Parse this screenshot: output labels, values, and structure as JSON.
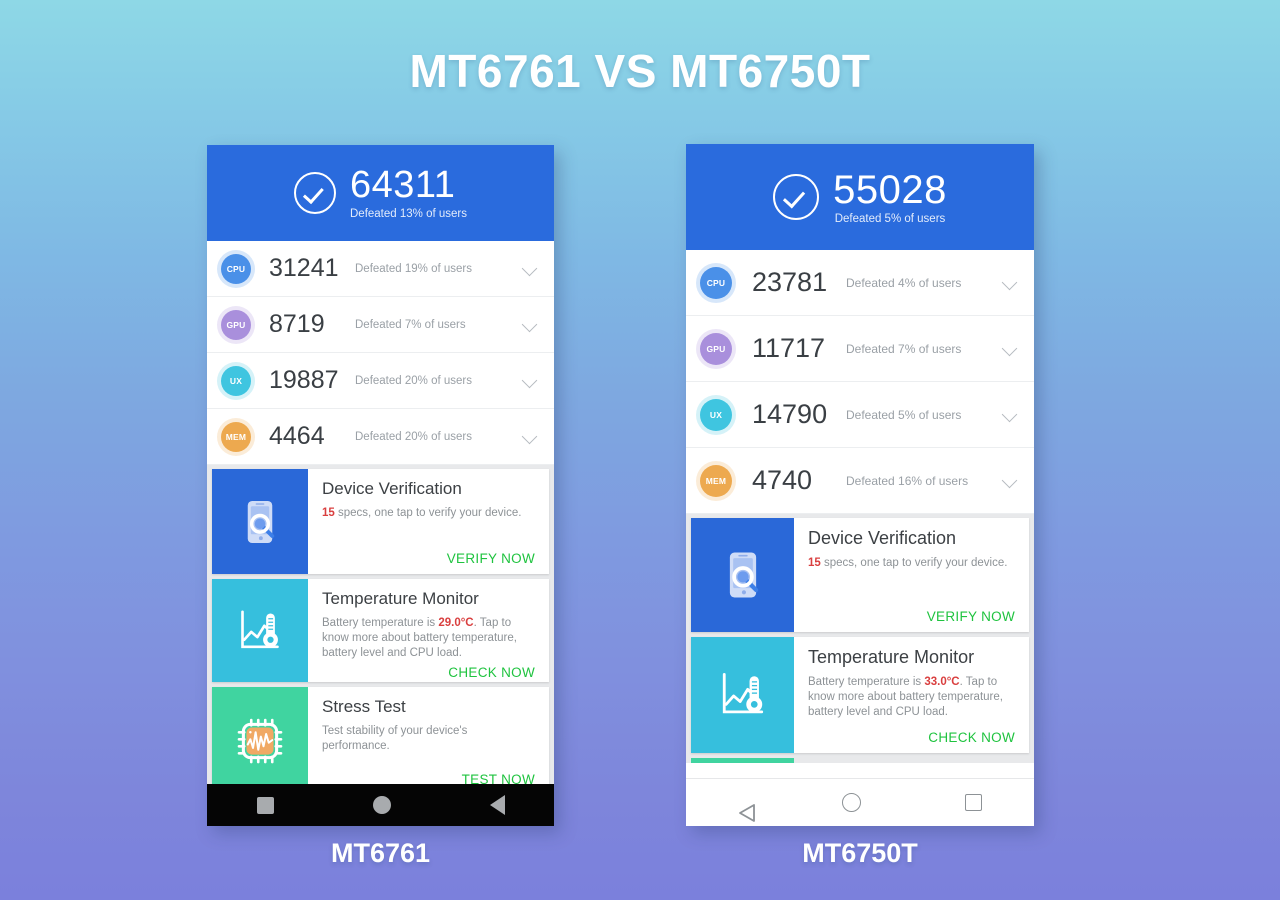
{
  "page": {
    "title": "MT6761 VS MT6750T",
    "background_top_color": "#8ed8e6",
    "background_bottom_color": "#7b80dc"
  },
  "devices": [
    {
      "caption": "MT6761",
      "header": {
        "total_score": "64311",
        "defeated_text": "Defeated 13% of users",
        "header_color": "#2a6bdd"
      },
      "metrics": [
        {
          "badge": "CPU",
          "value": "31241",
          "defeated": "Defeated 19% of users",
          "color": "#4a90e8"
        },
        {
          "badge": "GPU",
          "value": "8719",
          "defeated": "Defeated 7% of users",
          "color": "#a98fdc"
        },
        {
          "badge": "UX",
          "value": "19887",
          "defeated": "Defeated 20% of users",
          "color": "#3fc5e0"
        },
        {
          "badge": "MEM",
          "value": "4464",
          "defeated": "Defeated 20% of users",
          "color": "#eda94f"
        }
      ],
      "cards": [
        {
          "title": "Device Verification",
          "desc_highlight": "15",
          "desc_rest": " specs, one tap to verify your device.",
          "cta": "VERIFY NOW",
          "thumb_color": "#2a68d8",
          "icon": "phone-magnifier-icon"
        },
        {
          "title": "Temperature Monitor",
          "desc_prefix": "Battery temperature is ",
          "desc_highlight": "29.0°C",
          "desc_rest": ". Tap to know more about battery temperature, battery level and CPU load.",
          "cta": "CHECK NOW",
          "thumb_color": "#36bfdd",
          "icon": "thermometer-chart-icon"
        },
        {
          "title": "Stress Test",
          "desc_prefix": "Test stability of your device's performance.",
          "desc_highlight": "",
          "desc_rest": "",
          "cta": "TEST NOW",
          "thumb_color": "#40d4a0",
          "icon": "cpu-waveform-icon"
        }
      ],
      "navbar": {
        "style": "dark",
        "buttons": [
          "recent-apps-icon",
          "home-icon",
          "back-icon"
        ]
      }
    },
    {
      "caption": "MT6750T",
      "header": {
        "total_score": "55028",
        "defeated_text": "Defeated 5% of users",
        "header_color": "#2a6bdd"
      },
      "metrics": [
        {
          "badge": "CPU",
          "value": "23781",
          "defeated": "Defeated 4% of users",
          "color": "#4a90e8"
        },
        {
          "badge": "GPU",
          "value": "11717",
          "defeated": "Defeated 7% of users",
          "color": "#a98fdc"
        },
        {
          "badge": "UX",
          "value": "14790",
          "defeated": "Defeated 5% of users",
          "color": "#3fc5e0"
        },
        {
          "badge": "MEM",
          "value": "4740",
          "defeated": "Defeated 16% of users",
          "color": "#eda94f"
        }
      ],
      "cards": [
        {
          "title": "Device Verification",
          "desc_highlight": "15",
          "desc_rest": " specs, one tap to verify your device.",
          "cta": "VERIFY NOW",
          "thumb_color": "#2a68d8",
          "icon": "phone-magnifier-icon"
        },
        {
          "title": "Temperature Monitor",
          "desc_prefix": "Battery temperature is ",
          "desc_highlight": "33.0°C",
          "desc_rest": ". Tap to know more about battery temperature, battery level and CPU load.",
          "cta": "CHECK NOW",
          "thumb_color": "#36bfdd",
          "icon": "thermometer-chart-icon"
        }
      ],
      "navbar": {
        "style": "light",
        "buttons": [
          "back-icon",
          "home-icon",
          "recent-apps-icon"
        ]
      }
    }
  ]
}
